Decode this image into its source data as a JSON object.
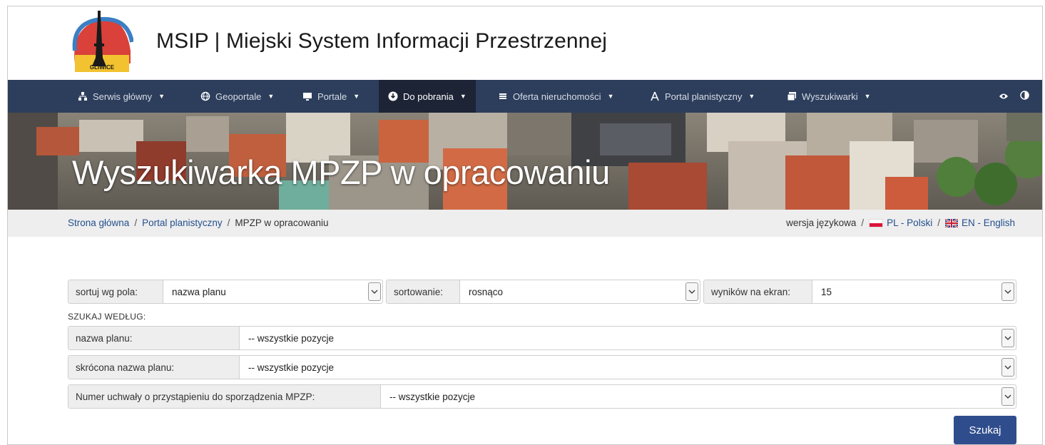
{
  "header": {
    "logo_text": "GLIWICE",
    "title": "MSIP | Miejski System Informacji Przestrzennej"
  },
  "nav": {
    "items": [
      {
        "label": "Serwis główny",
        "icon": "sitemap-icon"
      },
      {
        "label": "Geoportale",
        "icon": "globe-icon"
      },
      {
        "label": "Portale",
        "icon": "monitor-icon"
      },
      {
        "label": "Do pobrania",
        "icon": "download-icon",
        "active": true
      },
      {
        "label": "Oferta nieruchomości",
        "icon": "list-icon"
      },
      {
        "label": "Portal planistyczny",
        "icon": "drafting-compass-icon"
      },
      {
        "label": "Wyszukiwarki",
        "icon": "images-icon"
      }
    ],
    "right_icons": [
      "eye-icon",
      "contrast-icon"
    ],
    "bg_color": "#2d3e5c",
    "active_color": "#1d2436"
  },
  "banner": {
    "title": "Wyszukiwarka MPZP w opracowaniu"
  },
  "breadcrumb": {
    "items": [
      "Strona główna",
      "Portal planistyczny",
      "MPZP w opracowaniu"
    ],
    "separator": "/"
  },
  "language": {
    "label": "wersja językowa",
    "separator": "/",
    "pl": "PL - Polski",
    "en": "EN - English"
  },
  "form": {
    "sort_field_label": "sortuj wg pola:",
    "sort_field_value": "nazwa planu",
    "sort_order_label": "sortowanie:",
    "sort_order_value": "rosnąco",
    "per_page_label": "wyników na ekran:",
    "per_page_value": "15",
    "search_by_label": "SZUKAJ WEDŁUG:",
    "filters": [
      {
        "label": "nazwa planu:",
        "value": "-- wszystkie pozycje"
      },
      {
        "label": "skrócona nazwa planu:",
        "value": "-- wszystkie pozycje"
      },
      {
        "label": "Numer uchwały o przystąpieniu do sporządzenia MPZP:",
        "value": "-- wszystkie pozycje"
      }
    ],
    "submit_label": "Szukaj"
  },
  "colors": {
    "accent": "#2f4d8c",
    "link": "#24508f"
  }
}
